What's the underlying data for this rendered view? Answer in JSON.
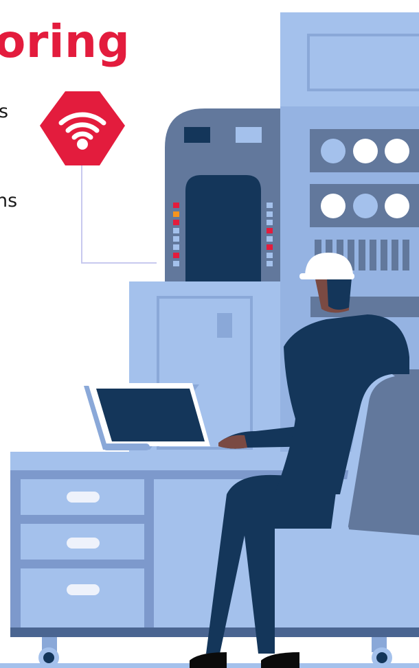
{
  "heading": "oring",
  "text_fragments": [
    "s",
    "ns"
  ],
  "colors": {
    "accent": "#e31c3d",
    "machine_light": "#a4c1ec",
    "machine_mid": "#8aa8d8",
    "machine_dark": "#62789c",
    "navy": "#14365a",
    "desk": "#7d99cc"
  },
  "icons": [
    "wifi-icon"
  ]
}
